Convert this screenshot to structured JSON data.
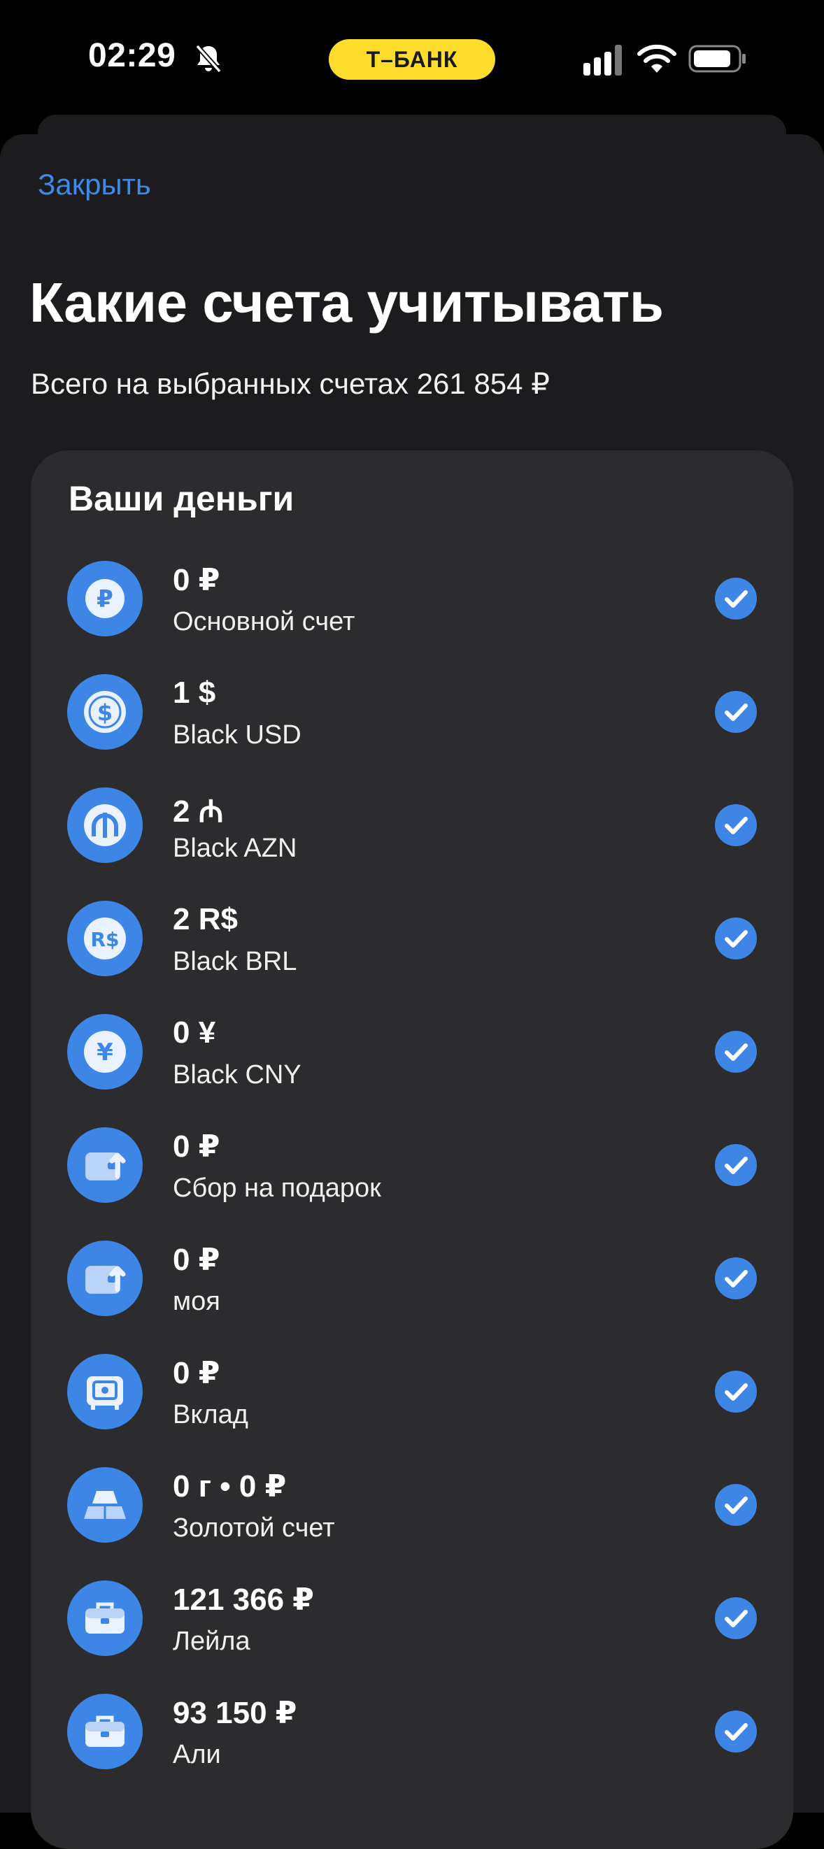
{
  "status": {
    "time": "02:29",
    "carrier_badge": "Т–БАНК",
    "icons": [
      "bell-slash-icon",
      "signal-icon",
      "wifi-icon",
      "battery-icon"
    ]
  },
  "header": {
    "close_label": "Закрыть",
    "title": "Какие счета учитывать",
    "subtitle": "Всего на выбранных счетах 261 854 ₽"
  },
  "card": {
    "title": "Ваши деньги",
    "accounts": [
      {
        "amount": "0 ₽",
        "name": "Основной счет",
        "icon": "ruble-coin-icon",
        "checked": true
      },
      {
        "amount": "1 $",
        "name": "Black USD",
        "icon": "dollar-coin-icon",
        "checked": true
      },
      {
        "amount": "2 ₼",
        "name": "Black AZN",
        "icon": "manat-coin-icon",
        "checked": true
      },
      {
        "amount": "2 R$",
        "name": "Black BRL",
        "icon": "real-coin-icon",
        "checked": true
      },
      {
        "amount": "0 ¥",
        "name": "Black CNY",
        "icon": "yuan-coin-icon",
        "checked": true
      },
      {
        "amount": "0 ₽",
        "name": "Сбор на подарок",
        "icon": "wallet-arrow-icon",
        "checked": true
      },
      {
        "amount": "0 ₽",
        "name": "моя",
        "icon": "wallet-arrow-icon",
        "checked": true
      },
      {
        "amount": "0 ₽",
        "name": "Вклад",
        "icon": "safe-icon",
        "checked": true
      },
      {
        "amount": "0 г • 0 ₽",
        "name": "Золотой счет",
        "icon": "gold-bars-icon",
        "checked": true
      },
      {
        "amount": "121 366 ₽",
        "name": "Лейла",
        "icon": "briefcase-icon",
        "checked": true
      },
      {
        "amount": "93 150 ₽",
        "name": "Али",
        "icon": "briefcase-icon",
        "checked": true
      }
    ]
  },
  "colors": {
    "accent": "#3d86e5",
    "link": "#3d8ae8",
    "badge": "#ffdd2d",
    "card": "#2c2c2e",
    "sheet": "#1c1c1e"
  }
}
